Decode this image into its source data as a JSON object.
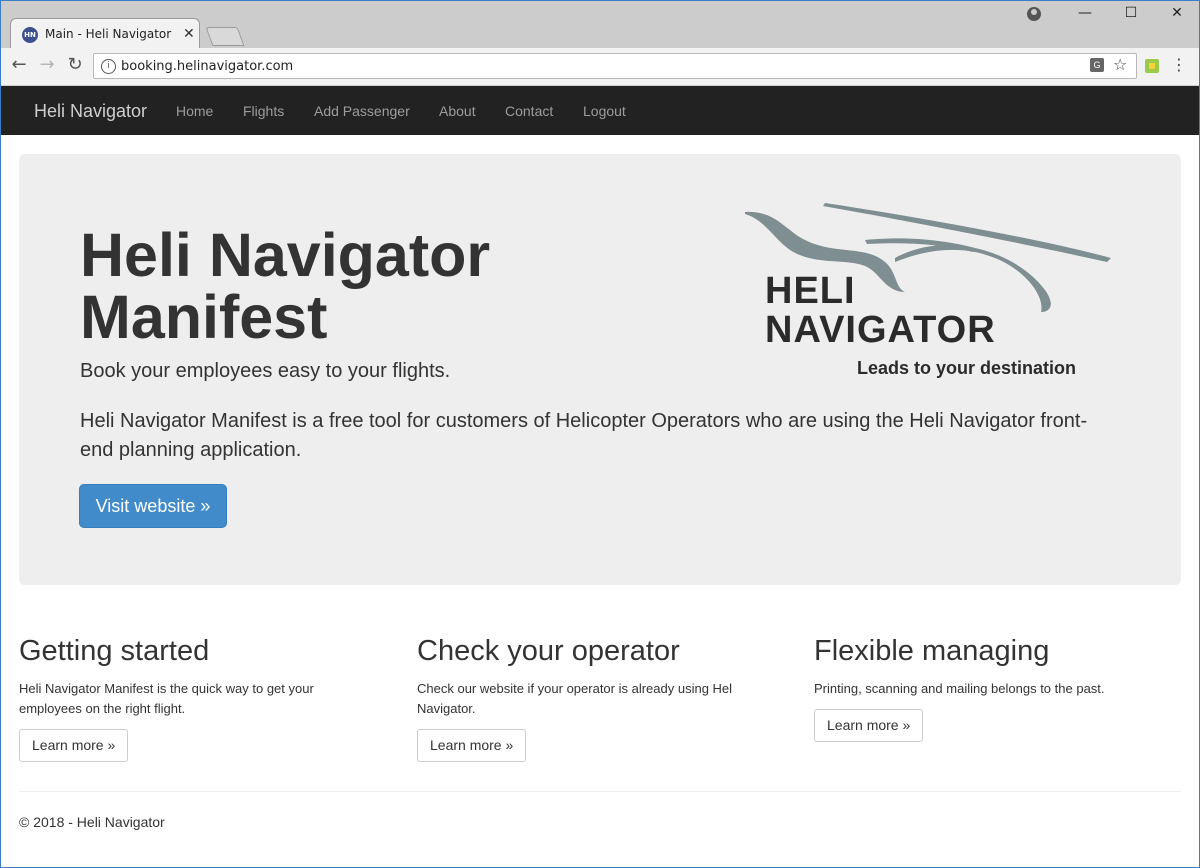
{
  "browser": {
    "tab_title": "Main - Heli Navigator",
    "favicon_text": "HN",
    "url": "booking.helinavigator.com",
    "icons": [
      "account-icon",
      "minimize-icon",
      "maximize-icon",
      "close-icon",
      "back-icon",
      "forward-icon",
      "reload-icon",
      "info-icon",
      "translate-icon",
      "star-icon",
      "extension-icon",
      "menu-icon"
    ]
  },
  "navbar": {
    "brand": "Heli Navigator",
    "links": [
      "Home",
      "Flights",
      "Add Passenger",
      "About",
      "Contact",
      "Logout"
    ]
  },
  "hero": {
    "title_line1": "Heli Navigator",
    "title_line2": "Manifest",
    "lead": "Book your employees easy to your flights.",
    "description": "Heli Navigator Manifest is a free tool for customers of Helicopter Operators who are using the Heli Navigator front-end planning application.",
    "button": "Visit website »"
  },
  "logo": {
    "line1": "HELI",
    "line2": "NAVIGATOR",
    "tagline": "Leads to your destination"
  },
  "columns": [
    {
      "title": "Getting started",
      "text": "Heli Navigator Manifest is the quick way to get your employees on the right flight.",
      "button": "Learn more »"
    },
    {
      "title": "Check your operator",
      "text": "Check our website if your operator is already using Hel Navigator.",
      "button": "Learn more »"
    },
    {
      "title": "Flexible managing",
      "text": "Printing, scanning and mailing belongs to the past.",
      "button": "Learn more »"
    }
  ],
  "footer": "© 2018 - Heli Navigator",
  "colors": {
    "navbar_bg": "#222222",
    "jumbotron_bg": "#eeeeee",
    "primary_button": "#428bca",
    "logo_swoosh": "#7f8f91"
  }
}
